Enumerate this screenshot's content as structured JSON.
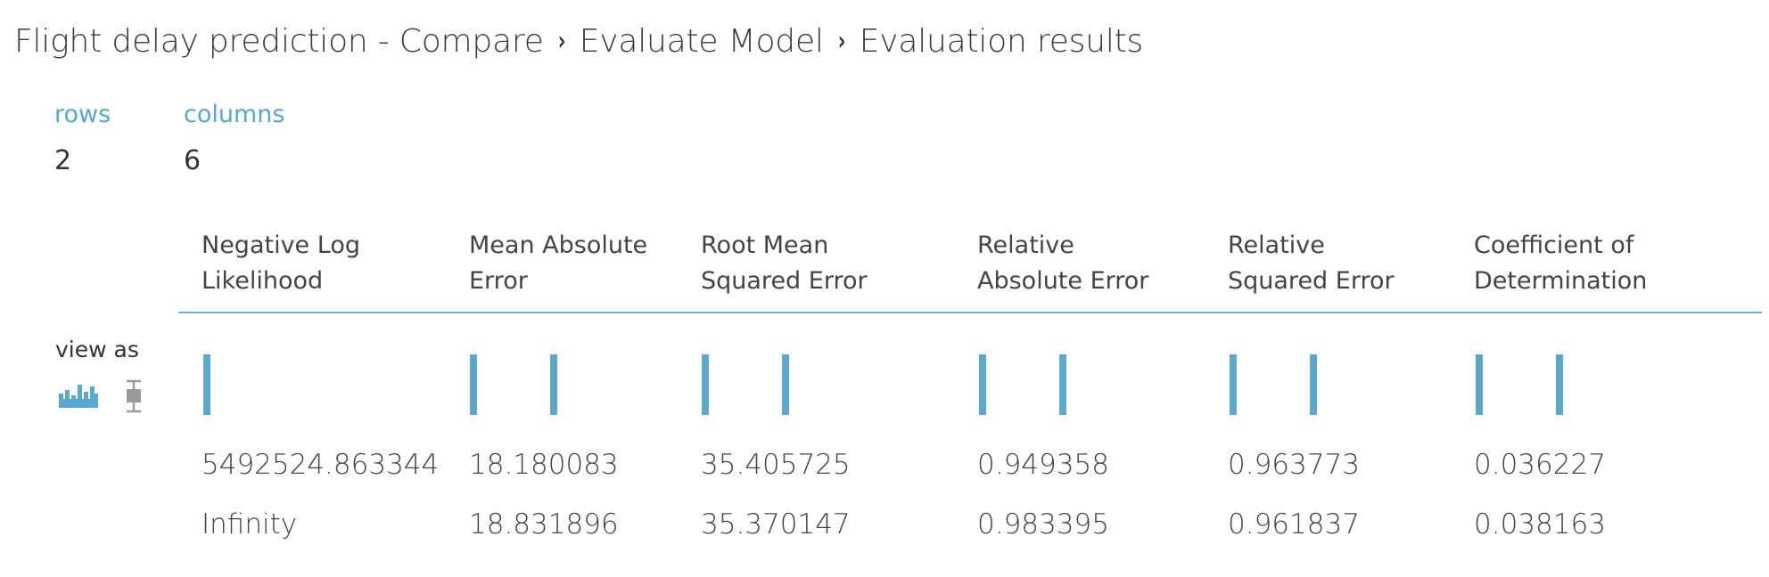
{
  "breadcrumb": {
    "items": [
      "Flight delay prediction - Compare",
      "Evaluate Model",
      "Evaluation results"
    ],
    "separator": "›"
  },
  "stats": {
    "rows_label": "rows",
    "rows_value": "2",
    "columns_label": "columns",
    "columns_value": "6"
  },
  "view_as": {
    "label": "view as",
    "icons": [
      "histogram-icon",
      "boxplot-icon"
    ],
    "active_color": "#5ba8cc",
    "inactive_color": "#9a9a9a"
  },
  "table": {
    "columns": [
      "Negative Log\nLikelihood",
      "Mean Absolute\nError",
      "Root Mean\nSquared Error",
      "Relative\nAbsolute Error",
      "Relative\nSquared Error",
      "Coefficient of\nDetermination"
    ],
    "rows": [
      [
        "5492524.863344",
        "18.180083",
        "35.405725",
        "0.949358",
        "0.963773",
        "0.036227"
      ],
      [
        "Infinity",
        "18.831896",
        "35.370147",
        "0.983395",
        "0.961837",
        "0.038163"
      ]
    ]
  },
  "colors": {
    "accent": "#5ba8cc",
    "label_blue": "#5aa6c9",
    "text": "#333333"
  }
}
